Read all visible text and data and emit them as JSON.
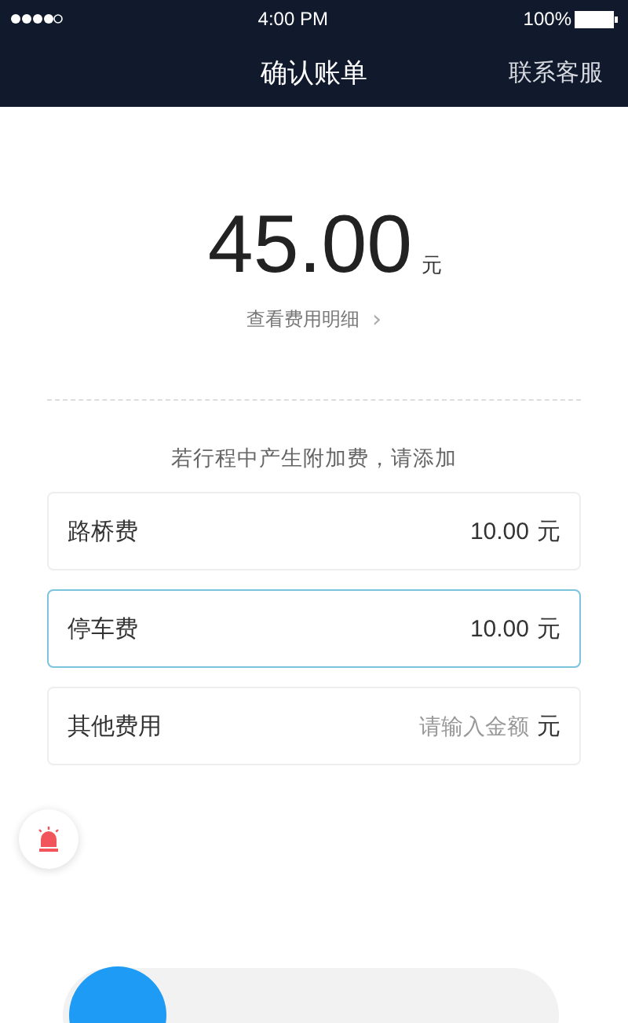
{
  "status_bar": {
    "time": "4:00 PM",
    "battery": "100%"
  },
  "nav_bar": {
    "title": "确认账单",
    "action": "联系客服"
  },
  "fare": {
    "amount": "45.00",
    "unit": "元",
    "details_link": "查看费用明细",
    "details_arrow": "›"
  },
  "extra_fees": {
    "hint": "若行程中产生附加费，请添加",
    "rows": [
      {
        "label": "路桥费",
        "value": "10.00",
        "unit": "元",
        "focused": false
      },
      {
        "label": "停车费",
        "value": "10.00",
        "unit": "元",
        "focused": true
      },
      {
        "label": "其他费用",
        "placeholder": "请输入金额",
        "unit": "元",
        "focused": false
      }
    ]
  }
}
